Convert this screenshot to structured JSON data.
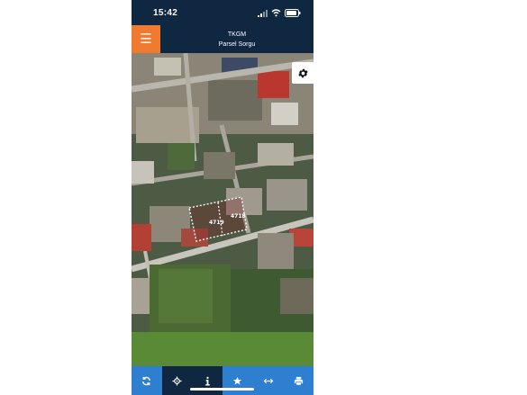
{
  "status_bar": {
    "time": "15:42"
  },
  "header": {
    "menu_icon": "hamburger-icon",
    "title": "TKGM",
    "subtitle": "Parsel Sorgu"
  },
  "map": {
    "settings_icon": "gear-icon",
    "parcel_labels": [
      "4719",
      "4718"
    ]
  },
  "toolbar": {
    "items": [
      {
        "icon": "refresh-icon",
        "active": false
      },
      {
        "icon": "locate-icon",
        "active": true
      },
      {
        "icon": "info-icon",
        "active": false
      },
      {
        "icon": "star-icon",
        "active": false
      },
      {
        "icon": "measure-icon",
        "active": false
      },
      {
        "icon": "print-icon",
        "active": false
      }
    ]
  },
  "colors": {
    "header_bg": "#0f2741",
    "menu_accent": "#f07a30",
    "toolbar_bg": "#2f7fd1"
  }
}
